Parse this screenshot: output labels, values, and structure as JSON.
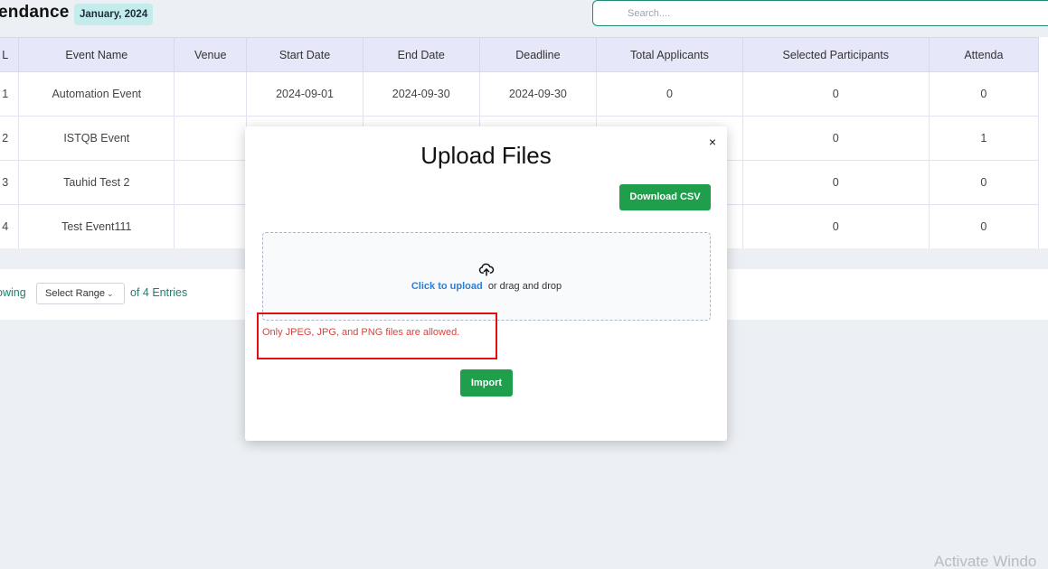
{
  "header": {
    "title": "endance",
    "month_badge": "January, 2024",
    "search_placeholder": "Search...."
  },
  "table": {
    "columns": [
      "L",
      "Event Name",
      "Venue",
      "Start Date",
      "End Date",
      "Deadline",
      "Total Applicants",
      "Selected Participants",
      "Attenda"
    ],
    "rows": [
      [
        "1",
        "Automation Event",
        "",
        "2024-09-01",
        "2024-09-30",
        "2024-09-30",
        "0",
        "0",
        "0"
      ],
      [
        "2",
        "ISTQB Event",
        "",
        "",
        "",
        "",
        "",
        "0",
        "1"
      ],
      [
        "3",
        "Tauhid Test 2",
        "",
        "",
        "",
        "",
        "",
        "0",
        "0"
      ],
      [
        "4",
        "Test Event111",
        "",
        "",
        "",
        "",
        "",
        "0",
        "0"
      ]
    ]
  },
  "footer": {
    "showing_label": "owing",
    "range_label": "Select Range",
    "entries_label": "of 4 Entries"
  },
  "modal": {
    "title": "Upload Files",
    "close_label": "×",
    "download_button": "Download CSV",
    "click_to_upload": "Click to upload",
    "drag_drop": "or drag and drop",
    "error": "Only JPEG, JPG, and PNG files are allowed.",
    "import_button": "Import"
  },
  "watermark": "Activate Windo",
  "colors": {
    "accent_green": "#1f9e4c",
    "header_row": "#e6e7f8",
    "error_red": "#e0403a",
    "link_blue": "#2d7fd6",
    "highlight_red": "#e01010"
  },
  "icons": {
    "upload": "cloud-upload-icon",
    "chevron": "chevron-down-icon",
    "close": "close-icon"
  }
}
